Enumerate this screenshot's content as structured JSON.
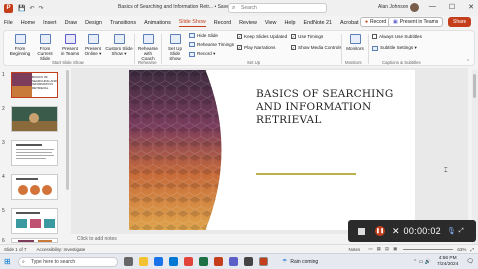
{
  "titlebar": {
    "qa_icons": [
      "save",
      "undo",
      "redo"
    ],
    "document_title": "Basics of Searching and Information Retr... • Saved ▾",
    "search_placeholder": "Search",
    "user_name": "Alan Johnson",
    "window_buttons": [
      "—",
      "☐",
      "✕"
    ]
  },
  "tabs": [
    "File",
    "Home",
    "Insert",
    "Draw",
    "Design",
    "Transitions",
    "Animations",
    "Slide Show",
    "Record",
    "Review",
    "View",
    "Help",
    "EndNote 21",
    "Acrobat"
  ],
  "active_tab": "Slide Show",
  "header_actions": {
    "record": "Record",
    "present": "Present in Teams",
    "share": "Share"
  },
  "ribbon": {
    "groups": {
      "start": "Start Slide Show",
      "rehearse": "Rehearse",
      "setup": "Set Up",
      "monitors": "Monitors",
      "captions": "Captions & Subtitles"
    },
    "buttons": {
      "from_beginning": "From Beginning",
      "from_current": "From Current Slide",
      "present_teams": "Present in Teams",
      "present_online": "Present Online ▾",
      "custom_show": "Custom Slide Show ▾",
      "rehearse_coach": "Rehearse with Coach",
      "setup_show": "Set Up Slide Show",
      "hide_slide": "Hide Slide",
      "rehearse_timings": "Rehearse Timings",
      "record_small": "Record ▾",
      "keep_updated": "Keep Slides Updated",
      "play_narrations": "Play Narrations",
      "use_timings": "Use Timings",
      "show_media": "Show Media Controls",
      "monitors": "Monitors",
      "always_subtitles": "Always Use Subtitles",
      "subtitle_settings": "Subtitle Settings ▾"
    }
  },
  "thumbnails": [
    {
      "num": "1",
      "caption": "BASICS OF SEARCHING AND INFORMATION RETRIEVAL"
    },
    {
      "num": "2",
      "caption": ""
    },
    {
      "num": "3",
      "caption": ""
    },
    {
      "num": "4",
      "caption": ""
    },
    {
      "num": "5",
      "caption": ""
    },
    {
      "num": "6",
      "caption": ""
    }
  ],
  "slide": {
    "title_line1": "BASICS OF SEARCHING",
    "title_line2": "AND INFORMATION",
    "title_line3": "RETRIEVAL"
  },
  "notes_placeholder": "Click to add notes",
  "recording": {
    "timer": "00:00:02"
  },
  "statusbar": {
    "slide_count": "Slide 1 of 7",
    "accessibility": "Accessibility: Investigate",
    "notes": "Notes",
    "zoom": "63%"
  },
  "taskbar": {
    "search": "Type here to search",
    "weather": "Rain coming",
    "time": "4:56 PM",
    "date": "7/24/2024"
  }
}
